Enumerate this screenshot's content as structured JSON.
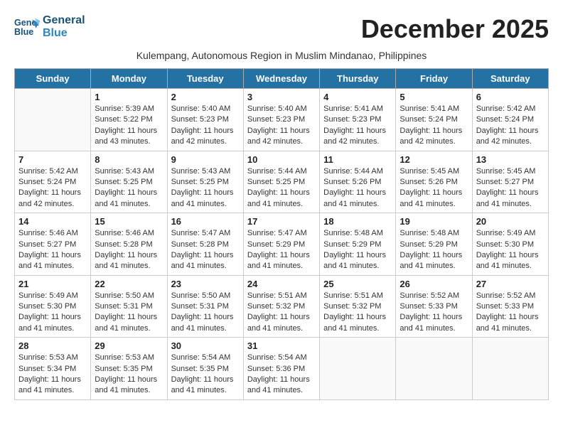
{
  "logo": {
    "line1": "General",
    "line2": "Blue"
  },
  "title": "December 2025",
  "subtitle": "Kulempang, Autonomous Region in Muslim Mindanao, Philippines",
  "weekdays": [
    "Sunday",
    "Monday",
    "Tuesday",
    "Wednesday",
    "Thursday",
    "Friday",
    "Saturday"
  ],
  "weeks": [
    [
      {
        "day": "",
        "sunrise": "",
        "sunset": "",
        "daylight": ""
      },
      {
        "day": "1",
        "sunrise": "Sunrise: 5:39 AM",
        "sunset": "Sunset: 5:22 PM",
        "daylight": "Daylight: 11 hours and 43 minutes."
      },
      {
        "day": "2",
        "sunrise": "Sunrise: 5:40 AM",
        "sunset": "Sunset: 5:23 PM",
        "daylight": "Daylight: 11 hours and 42 minutes."
      },
      {
        "day": "3",
        "sunrise": "Sunrise: 5:40 AM",
        "sunset": "Sunset: 5:23 PM",
        "daylight": "Daylight: 11 hours and 42 minutes."
      },
      {
        "day": "4",
        "sunrise": "Sunrise: 5:41 AM",
        "sunset": "Sunset: 5:23 PM",
        "daylight": "Daylight: 11 hours and 42 minutes."
      },
      {
        "day": "5",
        "sunrise": "Sunrise: 5:41 AM",
        "sunset": "Sunset: 5:24 PM",
        "daylight": "Daylight: 11 hours and 42 minutes."
      },
      {
        "day": "6",
        "sunrise": "Sunrise: 5:42 AM",
        "sunset": "Sunset: 5:24 PM",
        "daylight": "Daylight: 11 hours and 42 minutes."
      }
    ],
    [
      {
        "day": "7",
        "sunrise": "Sunrise: 5:42 AM",
        "sunset": "Sunset: 5:24 PM",
        "daylight": "Daylight: 11 hours and 42 minutes."
      },
      {
        "day": "8",
        "sunrise": "Sunrise: 5:43 AM",
        "sunset": "Sunset: 5:25 PM",
        "daylight": "Daylight: 11 hours and 41 minutes."
      },
      {
        "day": "9",
        "sunrise": "Sunrise: 5:43 AM",
        "sunset": "Sunset: 5:25 PM",
        "daylight": "Daylight: 11 hours and 41 minutes."
      },
      {
        "day": "10",
        "sunrise": "Sunrise: 5:44 AM",
        "sunset": "Sunset: 5:25 PM",
        "daylight": "Daylight: 11 hours and 41 minutes."
      },
      {
        "day": "11",
        "sunrise": "Sunrise: 5:44 AM",
        "sunset": "Sunset: 5:26 PM",
        "daylight": "Daylight: 11 hours and 41 minutes."
      },
      {
        "day": "12",
        "sunrise": "Sunrise: 5:45 AM",
        "sunset": "Sunset: 5:26 PM",
        "daylight": "Daylight: 11 hours and 41 minutes."
      },
      {
        "day": "13",
        "sunrise": "Sunrise: 5:45 AM",
        "sunset": "Sunset: 5:27 PM",
        "daylight": "Daylight: 11 hours and 41 minutes."
      }
    ],
    [
      {
        "day": "14",
        "sunrise": "Sunrise: 5:46 AM",
        "sunset": "Sunset: 5:27 PM",
        "daylight": "Daylight: 11 hours and 41 minutes."
      },
      {
        "day": "15",
        "sunrise": "Sunrise: 5:46 AM",
        "sunset": "Sunset: 5:28 PM",
        "daylight": "Daylight: 11 hours and 41 minutes."
      },
      {
        "day": "16",
        "sunrise": "Sunrise: 5:47 AM",
        "sunset": "Sunset: 5:28 PM",
        "daylight": "Daylight: 11 hours and 41 minutes."
      },
      {
        "day": "17",
        "sunrise": "Sunrise: 5:47 AM",
        "sunset": "Sunset: 5:29 PM",
        "daylight": "Daylight: 11 hours and 41 minutes."
      },
      {
        "day": "18",
        "sunrise": "Sunrise: 5:48 AM",
        "sunset": "Sunset: 5:29 PM",
        "daylight": "Daylight: 11 hours and 41 minutes."
      },
      {
        "day": "19",
        "sunrise": "Sunrise: 5:48 AM",
        "sunset": "Sunset: 5:29 PM",
        "daylight": "Daylight: 11 hours and 41 minutes."
      },
      {
        "day": "20",
        "sunrise": "Sunrise: 5:49 AM",
        "sunset": "Sunset: 5:30 PM",
        "daylight": "Daylight: 11 hours and 41 minutes."
      }
    ],
    [
      {
        "day": "21",
        "sunrise": "Sunrise: 5:49 AM",
        "sunset": "Sunset: 5:30 PM",
        "daylight": "Daylight: 11 hours and 41 minutes."
      },
      {
        "day": "22",
        "sunrise": "Sunrise: 5:50 AM",
        "sunset": "Sunset: 5:31 PM",
        "daylight": "Daylight: 11 hours and 41 minutes."
      },
      {
        "day": "23",
        "sunrise": "Sunrise: 5:50 AM",
        "sunset": "Sunset: 5:31 PM",
        "daylight": "Daylight: 11 hours and 41 minutes."
      },
      {
        "day": "24",
        "sunrise": "Sunrise: 5:51 AM",
        "sunset": "Sunset: 5:32 PM",
        "daylight": "Daylight: 11 hours and 41 minutes."
      },
      {
        "day": "25",
        "sunrise": "Sunrise: 5:51 AM",
        "sunset": "Sunset: 5:32 PM",
        "daylight": "Daylight: 11 hours and 41 minutes."
      },
      {
        "day": "26",
        "sunrise": "Sunrise: 5:52 AM",
        "sunset": "Sunset: 5:33 PM",
        "daylight": "Daylight: 11 hours and 41 minutes."
      },
      {
        "day": "27",
        "sunrise": "Sunrise: 5:52 AM",
        "sunset": "Sunset: 5:33 PM",
        "daylight": "Daylight: 11 hours and 41 minutes."
      }
    ],
    [
      {
        "day": "28",
        "sunrise": "Sunrise: 5:53 AM",
        "sunset": "Sunset: 5:34 PM",
        "daylight": "Daylight: 11 hours and 41 minutes."
      },
      {
        "day": "29",
        "sunrise": "Sunrise: 5:53 AM",
        "sunset": "Sunset: 5:35 PM",
        "daylight": "Daylight: 11 hours and 41 minutes."
      },
      {
        "day": "30",
        "sunrise": "Sunrise: 5:54 AM",
        "sunset": "Sunset: 5:35 PM",
        "daylight": "Daylight: 11 hours and 41 minutes."
      },
      {
        "day": "31",
        "sunrise": "Sunrise: 5:54 AM",
        "sunset": "Sunset: 5:36 PM",
        "daylight": "Daylight: 11 hours and 41 minutes."
      },
      {
        "day": "",
        "sunrise": "",
        "sunset": "",
        "daylight": ""
      },
      {
        "day": "",
        "sunrise": "",
        "sunset": "",
        "daylight": ""
      },
      {
        "day": "",
        "sunrise": "",
        "sunset": "",
        "daylight": ""
      }
    ]
  ]
}
